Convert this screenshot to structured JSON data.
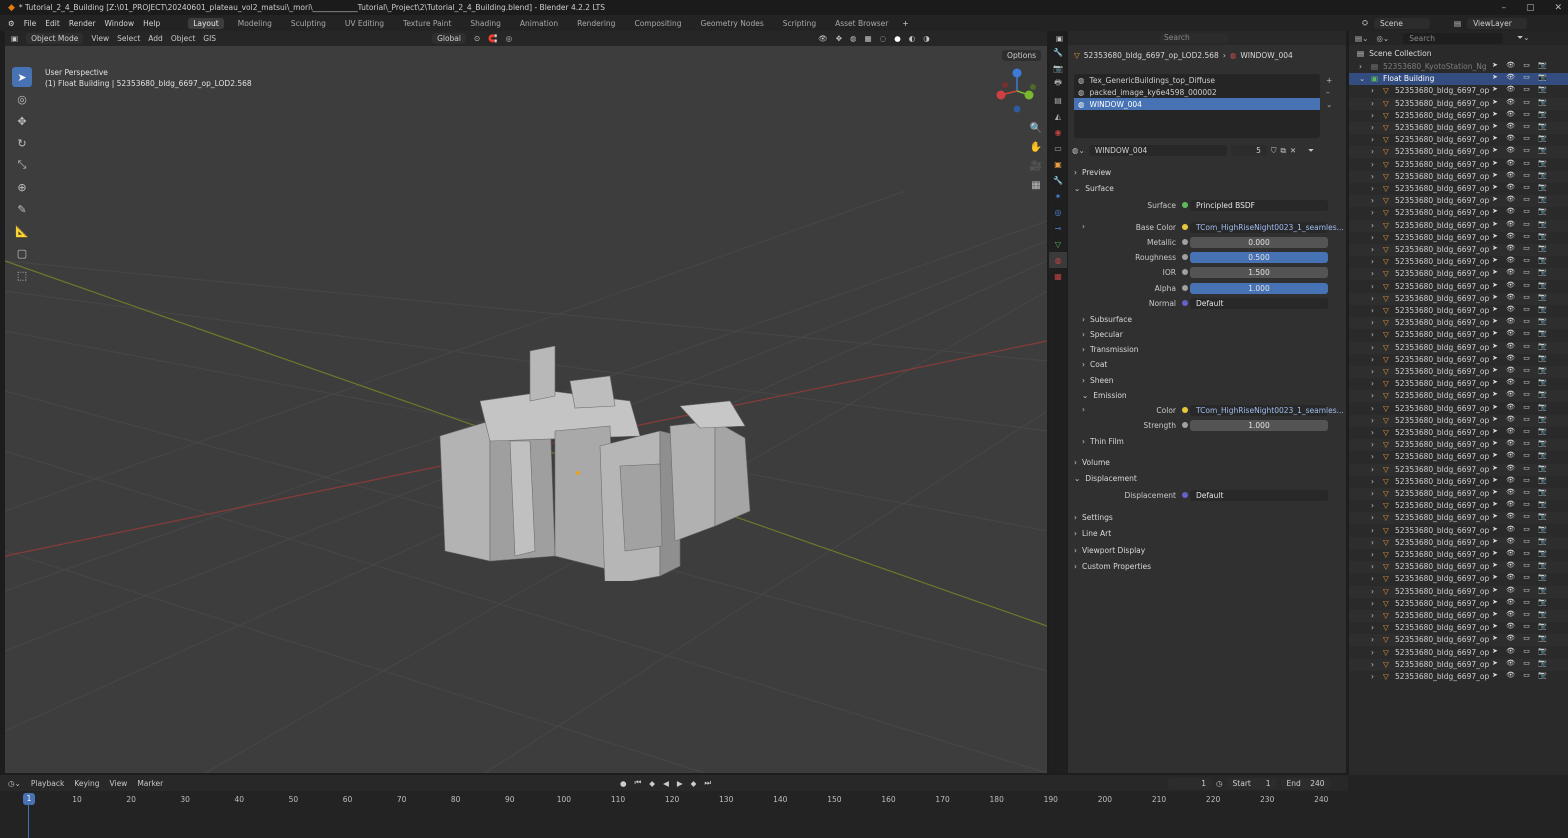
{
  "window": {
    "title": "* Tutorial_2_4_Building [Z:\\01_PROJECT\\20240601_plateau_vol2_matsui\\_mori\\____________Tutorial\\_Project\\2\\Tutorial_2_4_Building.blend] - Blender 4.2.2 LTS",
    "controls": [
      "–",
      "▢",
      "✕"
    ]
  },
  "menu": {
    "items": [
      "File",
      "Edit",
      "Render",
      "Window",
      "Help"
    ],
    "tabs": [
      "Layout",
      "Modeling",
      "Sculpting",
      "UV Editing",
      "Texture Paint",
      "Shading",
      "Animation",
      "Rendering",
      "Compositing",
      "Geometry Nodes",
      "Scripting",
      "Asset Browser"
    ],
    "active_tab": "Layout",
    "add": "+"
  },
  "scene": {
    "scene": "Scene",
    "view_layer": "ViewLayer"
  },
  "viewport": {
    "mode": "Object Mode",
    "menus": [
      "View",
      "Select",
      "Add",
      "Object"
    ],
    "gis": "GIS",
    "transform": "Global",
    "options": "Options",
    "info_line1": "User Perspective",
    "info_line2": "(1) Float Building | 52353680_bldg_6697_op_LOD2.568"
  },
  "properties": {
    "search_placeholder": "Search",
    "object": "52353680_bldg_6697_op_LOD2.568",
    "material": "WINDOW_004",
    "slots": [
      "Tex_GenericBuildings_top_Diffuse",
      "packed_image_ky6e4598_000002",
      "WINDOW_004"
    ],
    "material_name": "WINDOW_004",
    "users": "5",
    "sections": {
      "preview": "Preview",
      "surface": "Surface",
      "volume": "Volume",
      "displacement": "Displacement",
      "settings": "Settings",
      "line_art": "Line Art",
      "viewport_display": "Viewport Display",
      "custom_properties": "Custom Properties"
    },
    "surface": {
      "label": "Surface",
      "value": "Principled BSDF"
    },
    "fields": [
      {
        "label": "Base Color",
        "value": "TCom_HighRiseNight0023_1_seamles..."
      },
      {
        "label": "Metallic",
        "value": "0.000"
      },
      {
        "label": "Roughness",
        "value": "0.500"
      },
      {
        "label": "IOR",
        "value": "1.500"
      },
      {
        "label": "Alpha",
        "value": "1.000"
      },
      {
        "label": "Normal",
        "value": "Default"
      }
    ],
    "subpanels": [
      "Subsurface",
      "Specular",
      "Transmission",
      "Coat",
      "Sheen",
      "Emission"
    ],
    "emission": {
      "color_label": "Color",
      "color_value": "TCom_HighRiseNight0023_1_seamles...",
      "strength_label": "Strength",
      "strength_value": "1.000"
    },
    "thin_film": "Thin Film",
    "displacement_field": {
      "label": "Displacement",
      "value": "Default"
    }
  },
  "outliner": {
    "search_placeholder": "Search",
    "root": "Scene Collection",
    "items": [
      "52353680_KyotoStation_Ng",
      "Float Building",
      "52353680_bldg_6697_op",
      "52353680_bldg_6697_op",
      "52353680_bldg_6697_op",
      "52353680_bldg_6697_op",
      "52353680_bldg_6697_op",
      "52353680_bldg_6697_op",
      "52353680_bldg_6697_op",
      "52353680_bldg_6697_op",
      "52353680_bldg_6697_op",
      "52353680_bldg_6697_op",
      "52353680_bldg_6697_op",
      "52353680_bldg_6697_op",
      "52353680_bldg_6697_op",
      "52353680_bldg_6697_op",
      "52353680_bldg_6697_op",
      "52353680_bldg_6697_op",
      "52353680_bldg_6697_op",
      "52353680_bldg_6697_op",
      "52353680_bldg_6697_op",
      "52353680_bldg_6697_op",
      "52353680_bldg_6697_op",
      "52353680_bldg_6697_op",
      "52353680_bldg_6697_op",
      "52353680_bldg_6697_op",
      "52353680_bldg_6697_op",
      "52353680_bldg_6697_op",
      "52353680_bldg_6697_op",
      "52353680_bldg_6697_op",
      "52353680_bldg_6697_op",
      "52353680_bldg_6697_op",
      "52353680_bldg_6697_op",
      "52353680_bldg_6697_op",
      "52353680_bldg_6697_op",
      "52353680_bldg_6697_op",
      "52353680_bldg_6697_op",
      "52353680_bldg_6697_op",
      "52353680_bldg_6697_op",
      "52353680_bldg_6697_op",
      "52353680_bldg_6697_op",
      "52353680_bldg_6697_op",
      "52353680_bldg_6697_op",
      "52353680_bldg_6697_op",
      "52353680_bldg_6697_op",
      "52353680_bldg_6697_op",
      "52353680_bldg_6697_op",
      "52353680_bldg_6697_op",
      "52353680_bldg_6697_op",
      "52353680_bldg_6697_op",
      "52353680_bldg_6697_op"
    ]
  },
  "timeline": {
    "menus": [
      "Playback",
      "Keying",
      "View",
      "Marker"
    ],
    "current": "1",
    "start_label": "Start",
    "start": "1",
    "end_label": "End",
    "end": "240",
    "ticks": [
      "10",
      "20",
      "30",
      "40",
      "50",
      "60",
      "70",
      "80",
      "90",
      "100",
      "110",
      "120",
      "130",
      "140",
      "150",
      "160",
      "170",
      "180",
      "190",
      "200",
      "210",
      "220",
      "230",
      "240"
    ]
  }
}
